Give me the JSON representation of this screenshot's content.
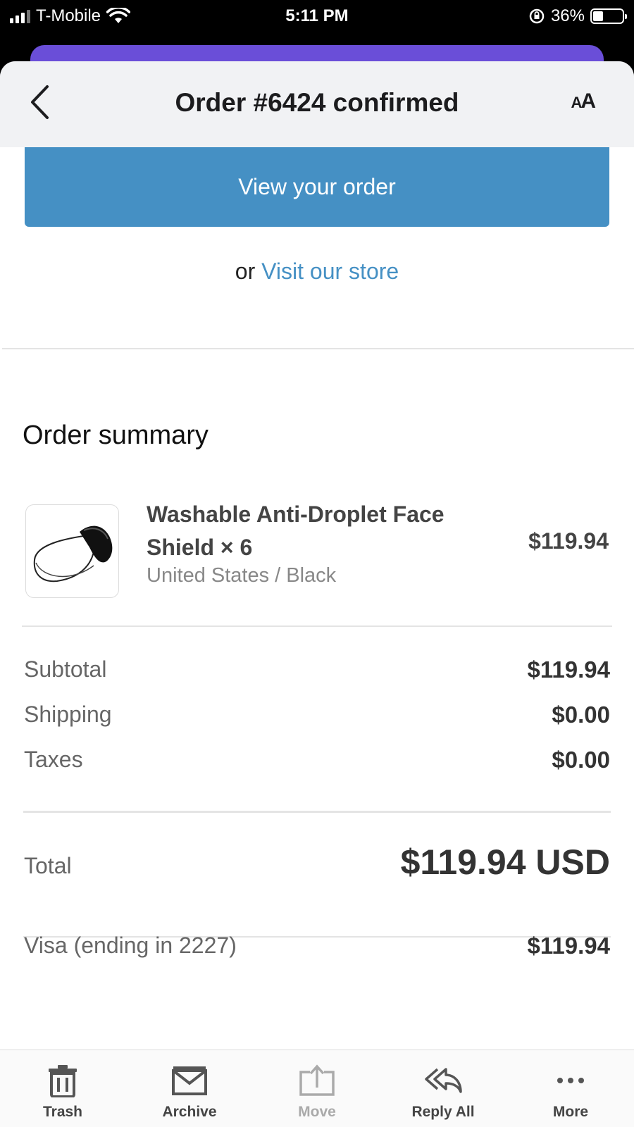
{
  "status_bar": {
    "carrier": "T-Mobile",
    "time": "5:11 PM",
    "battery_percent": "36%",
    "battery_level": 0.36
  },
  "nav": {
    "title": "Order #6424 confirmed",
    "text_size_label_big": "A",
    "text_size_label_small": "A"
  },
  "email": {
    "view_order_label": "View your order",
    "visit_prefix": "or",
    "visit_link": "Visit our store",
    "summary_title": "Order summary",
    "product": {
      "name": "Washable Anti-Droplet Face Shield × 6",
      "variant": "United States / Black",
      "price": "$119.94"
    },
    "costs": [
      {
        "label": "Subtotal",
        "value": "$119.94"
      },
      {
        "label": "Shipping",
        "value": "$0.00"
      },
      {
        "label": "Taxes",
        "value": "$0.00"
      }
    ],
    "total_label": "Total",
    "total_value": "$119.94 USD",
    "payment_label": "Visa (ending in 2227)",
    "payment_value": "$119.94"
  },
  "toolbar": {
    "items": [
      {
        "label": "Trash",
        "icon": "trash-icon",
        "enabled": true
      },
      {
        "label": "Archive",
        "icon": "archive-icon",
        "enabled": true
      },
      {
        "label": "Move",
        "icon": "move-icon",
        "enabled": false
      },
      {
        "label": "Reply All",
        "icon": "reply-all-icon",
        "enabled": true
      },
      {
        "label": "More",
        "icon": "more-icon",
        "enabled": true
      }
    ]
  },
  "colors": {
    "accent_blue": "#4590c4",
    "purple": "#6a4ed8"
  }
}
